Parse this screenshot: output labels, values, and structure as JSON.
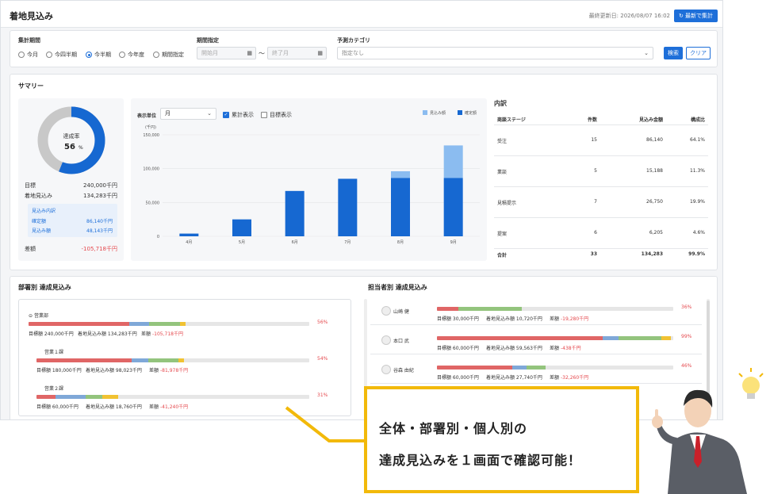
{
  "header": {
    "title": "着地見込み",
    "last_updated": "最終更新日: 2026/08/07 16:02",
    "refresh_button": "最新で集計"
  },
  "filters": {
    "period_label": "集計期間",
    "period_options": [
      "今月",
      "今四半期",
      "今半期",
      "今年度",
      "期間指定"
    ],
    "period_selected": "今半期",
    "range_label": "期間指定",
    "start_placeholder": "開始月",
    "tilde": "〜",
    "end_placeholder": "終了月",
    "category_label": "予測カテゴリ",
    "category_value": "指定なし",
    "search_button": "検索",
    "clear_button": "クリア"
  },
  "summary": {
    "title": "サマリー",
    "donut": {
      "label": "達成率",
      "value": "56",
      "unit": "%",
      "ratio": 0.56
    },
    "target_label": "目標",
    "target_value": "240,000千円",
    "forecast_label": "着地見込み",
    "forecast_value": "134,283千円",
    "breakdown_title": "見込み内訳",
    "confirmed_label": "確定額",
    "confirmed_value": "86,140千円",
    "expected_label": "見込み額",
    "expected_value": "48,143千円",
    "diff_label": "差額",
    "diff_value": "-105,718千円"
  },
  "chart_controls": {
    "unit_label": "表示単位",
    "unit_value": "月",
    "cumulative_label": "累計表示",
    "cumulative_checked": true,
    "goal_label": "目標表示",
    "goal_checked": false
  },
  "colors": {
    "accent": "#1e6fd9",
    "expected": "#8bbcf0",
    "confirmed": "#1668d1",
    "donut_track": "#c8c8c8",
    "danger": "#e5484d",
    "seg_red": "#e06666",
    "seg_blue": "#7fa8d8",
    "seg_green": "#93c47d",
    "seg_yellow": "#f1c232"
  },
  "chart_data": {
    "type": "bar",
    "stacked": true,
    "unit_label": "(千円)",
    "categories": [
      "4月",
      "5月",
      "6月",
      "7月",
      "8月",
      "9月"
    ],
    "ylim": [
      0,
      150000
    ],
    "yticks": [
      "150,000",
      "100,000",
      "50,000",
      "0"
    ],
    "ytick_values": [
      150000,
      100000,
      50000,
      0
    ],
    "series": [
      {
        "name": "確定額",
        "values": [
          4000,
          25000,
          67000,
          85000,
          86140,
          86140
        ]
      },
      {
        "name": "見込み額",
        "values": [
          0,
          0,
          0,
          0,
          10000,
          48143
        ]
      }
    ],
    "legend": [
      "見込み額",
      "確定額"
    ],
    "legend_position": "top-right"
  },
  "breakdown": {
    "title": "内訳",
    "headers": [
      "商談ステージ",
      "件数",
      "見込み金額",
      "構成比"
    ],
    "rows": [
      {
        "stage": "受注",
        "count": "15",
        "amount": "86,140",
        "ratio": "64.1%"
      },
      {
        "stage": "業談",
        "count": "5",
        "amount": "15,188",
        "ratio": "11.3%"
      },
      {
        "stage": "見積提示",
        "count": "7",
        "amount": "26,750",
        "ratio": "19.9%"
      },
      {
        "stage": "提案",
        "count": "6",
        "amount": "6,205",
        "ratio": "4.6%"
      }
    ],
    "total": {
      "stage": "合計",
      "count": "33",
      "amount": "134,283",
      "ratio": "99.9%"
    }
  },
  "departments": {
    "title": "部署別 達成見込み",
    "items": [
      {
        "name": "営業部",
        "percent": "56%",
        "detail_target": "目標額 240,000千円",
        "detail_forecast": "着地見込み額 134,283千円",
        "diff_label": "差額",
        "diff": "-105,718千円",
        "segments": [
          0.36,
          0.07,
          0.11,
          0.02
        ]
      },
      {
        "name": "営業１課",
        "percent": "54%",
        "detail_target": "目標額 180,000千円",
        "detail_forecast": "着地見込み額 98,023千円",
        "diff_label": "差額",
        "diff": "-81,978千円",
        "segments": [
          0.35,
          0.06,
          0.11,
          0.02
        ]
      },
      {
        "name": "営業２課",
        "percent": "31%",
        "detail_target": "目標額 60,000千円",
        "detail_forecast": "着地見込み額 18,760千円",
        "diff_label": "差額",
        "diff": "-41,240千円",
        "segments": [
          0.07,
          0.11,
          0.06,
          0.06
        ]
      }
    ]
  },
  "people": {
    "title": "担当者別 達成見込み",
    "items": [
      {
        "name": "山崎 健",
        "percent": "36%",
        "detail_target": "目標額 30,000千円",
        "detail_forecast": "着地見込み額 10,720千円",
        "diff_label": "差額",
        "diff": "-19,280千円",
        "segments": [
          0.09,
          0.0,
          0.27,
          0.0
        ]
      },
      {
        "name": "本口 武",
        "percent": "99%",
        "detail_target": "目標額 60,000千円",
        "detail_forecast": "着地見込み額 59,563千円",
        "diff_label": "差額",
        "diff": "-438千円",
        "segments": [
          0.7,
          0.07,
          0.18,
          0.04
        ]
      },
      {
        "name": "谷森 由紀",
        "percent": "46%",
        "detail_target": "目標額 60,000千円",
        "detail_forecast": "着地見込み額 27,740千円",
        "diff_label": "差額",
        "diff": "-32,260千円",
        "segments": [
          0.32,
          0.06,
          0.08,
          0.0
        ]
      }
    ]
  },
  "callout": {
    "line1": "全体・部署別・個人別の",
    "line2": "達成見込みを１画面で確認可能！"
  }
}
